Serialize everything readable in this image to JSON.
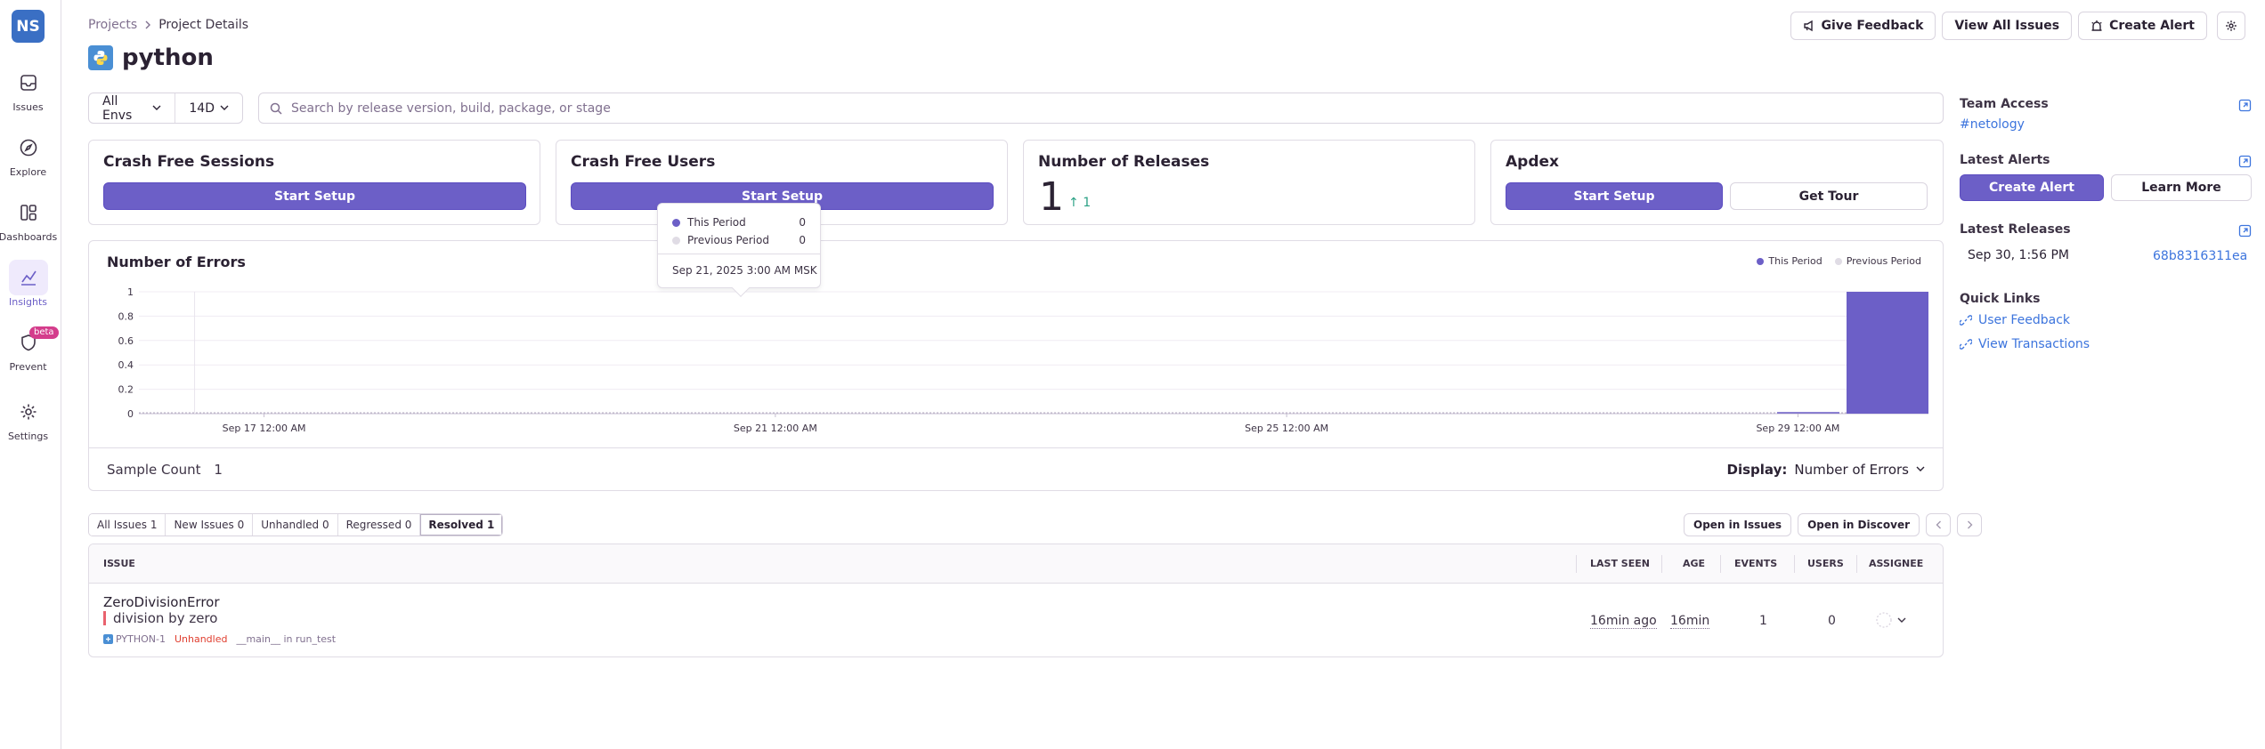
{
  "app": {
    "org_initials": "NS",
    "accent_color": "#6c5fc7"
  },
  "nav": {
    "items": [
      {
        "label": "Issues",
        "icon": "inbox-icon"
      },
      {
        "label": "Explore",
        "icon": "compass-icon"
      },
      {
        "label": "Dashboards",
        "icon": "dashboard-icon"
      },
      {
        "label": "Insights",
        "icon": "insights-icon",
        "active": true
      },
      {
        "label": "Prevent",
        "icon": "shield-icon",
        "badge": "beta"
      },
      {
        "label": "Settings",
        "icon": "gear-icon"
      }
    ]
  },
  "header": {
    "breadcrumb": [
      "Projects",
      "Project Details"
    ],
    "title": "python",
    "actions": {
      "give_feedback": "Give Feedback",
      "view_all_issues": "View All Issues",
      "create_alert": "Create Alert"
    }
  },
  "filters": {
    "environment": "All Envs",
    "period": "14D",
    "search_placeholder": "Search by release version, build, package, or stage"
  },
  "score_cards": {
    "crash_free_sessions": {
      "title": "Crash Free Sessions",
      "button": "Start Setup"
    },
    "crash_free_users": {
      "title": "Crash Free Users",
      "button": "Start Setup"
    },
    "releases": {
      "title": "Number of Releases",
      "count": "1",
      "delta": "1"
    },
    "apdex": {
      "title": "Apdex",
      "button_primary": "Start Setup",
      "button_secondary": "Get Tour"
    }
  },
  "chart": {
    "title": "Number of Errors",
    "legend": {
      "this_period": "This Period",
      "previous_period": "Previous Period"
    },
    "this_period_color": "#6c5fc7",
    "previous_period_color": "#e0dce5",
    "sample_count_label": "Sample Count",
    "sample_count_value": "1",
    "display_label": "Display:",
    "display_value": "Number of Errors",
    "tooltip": {
      "this_period_label": "This Period",
      "this_period_value": "0",
      "previous_period_label": "Previous Period",
      "previous_period_value": "0",
      "date": "Sep 21, 2025 3:00 AM MSK"
    }
  },
  "chart_data": {
    "type": "bar",
    "title": "Number of Errors",
    "y_ticks": [
      "1",
      "0.8",
      "0.6",
      "0.4",
      "0.2",
      "0"
    ],
    "x_ticks": [
      "Sep 17 12:00 AM",
      "Sep 21 12:00 AM",
      "Sep 25 12:00 AM",
      "Sep 29 12:00 AM"
    ],
    "ylim": [
      0,
      1
    ],
    "series": [
      {
        "name": "This Period",
        "values": [
          {
            "x": "Sep 30",
            "y": 1
          }
        ]
      },
      {
        "name": "Previous Period",
        "values": [
          {
            "x": "Sep 17",
            "y": 0
          }
        ]
      }
    ],
    "legend_position": "top-right"
  },
  "issues": {
    "tabs": [
      {
        "label": "All Issues",
        "count": "1"
      },
      {
        "label": "New Issues",
        "count": "0"
      },
      {
        "label": "Unhandled",
        "count": "0"
      },
      {
        "label": "Regressed",
        "count": "0"
      },
      {
        "label": "Resolved",
        "count": "1",
        "active": true
      }
    ],
    "open_in_issues": "Open in Issues",
    "open_in_discover": "Open in Discover",
    "columns": [
      "ISSUE",
      "LAST SEEN",
      "AGE",
      "EVENTS",
      "USERS",
      "ASSIGNEE"
    ],
    "rows": [
      {
        "title": "ZeroDivisionError",
        "message": "division by zero",
        "short_id": "PYTHON-1",
        "status": "Unhandled",
        "culprit": "__main__ in run_test",
        "last_seen": "16min ago",
        "age": "16min",
        "events": "1",
        "users": "0"
      }
    ]
  },
  "sidebar": {
    "team_access": {
      "title": "Team Access",
      "team": "#netology"
    },
    "latest_alerts": {
      "title": "Latest Alerts",
      "create": "Create Alert",
      "learn": "Learn More"
    },
    "latest_releases": {
      "title": "Latest Releases",
      "date": "Sep 30, 1:56 PM",
      "version": "68b8316311ea"
    },
    "quick_links": {
      "title": "Quick Links",
      "links": [
        "User Feedback",
        "View Transactions"
      ]
    }
  }
}
